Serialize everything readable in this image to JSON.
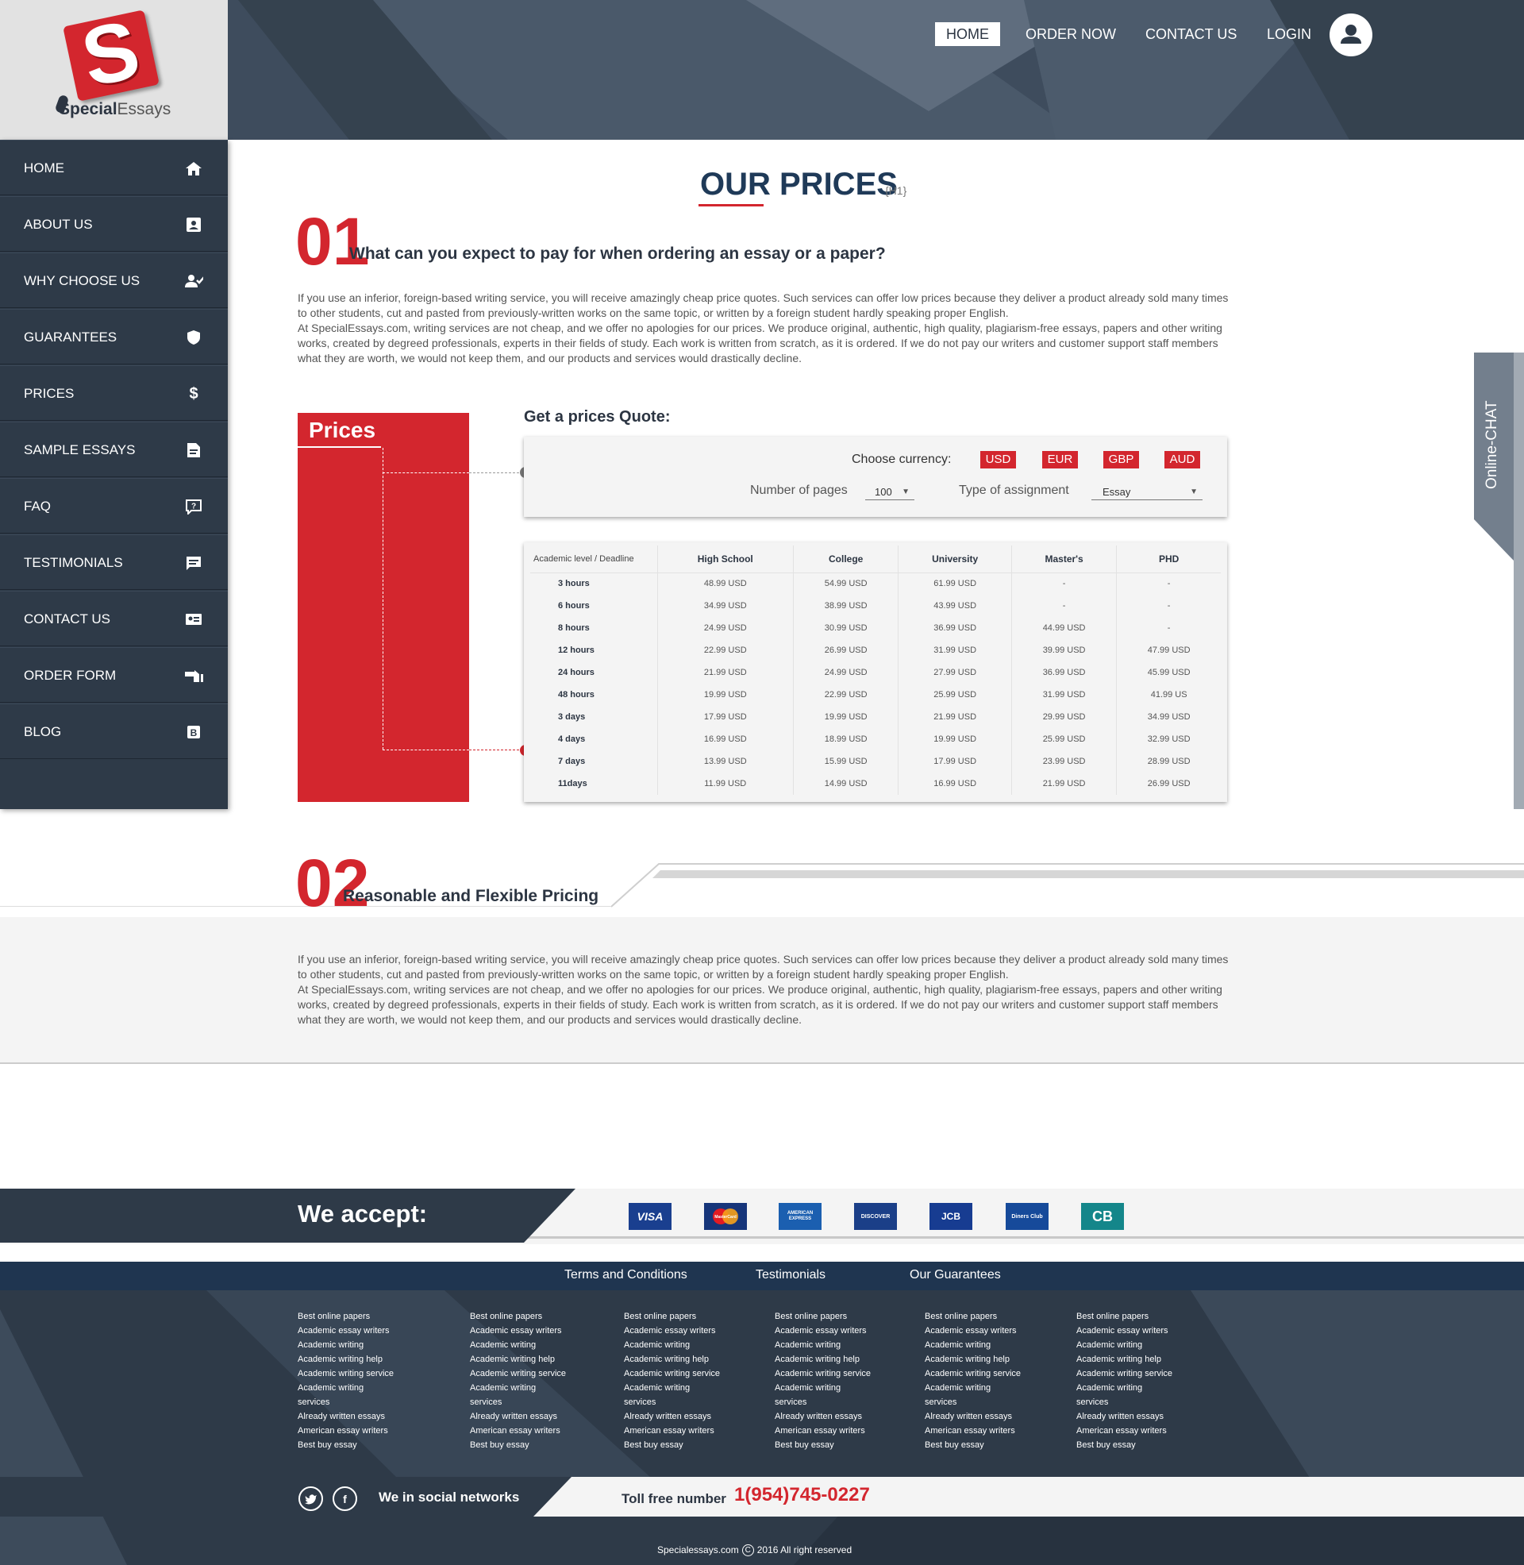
{
  "brand": {
    "name_bold": "Special",
    "name_light": "Essays",
    "logo_letter": "S"
  },
  "topnav": {
    "items": [
      {
        "label": "HOME",
        "active": true
      },
      {
        "label": "ORDER NOW",
        "active": false
      },
      {
        "label": "CONTACT US",
        "active": false
      },
      {
        "label": "LOGIN",
        "active": false
      }
    ],
    "avatar_icon": "user-icon"
  },
  "sidebar": {
    "items": [
      {
        "label": "HOME",
        "icon": "home-icon"
      },
      {
        "label": "ABOUT US",
        "icon": "contact-card-icon"
      },
      {
        "label": "WHY CHOOSE US",
        "icon": "user-check-icon"
      },
      {
        "label": "GUARANTEES",
        "icon": "shield-icon"
      },
      {
        "label": "PRICES",
        "icon": "dollar-icon"
      },
      {
        "label": "SAMPLE ESSAYS",
        "icon": "document-icon"
      },
      {
        "label": "FAQ",
        "icon": "question-bubble-icon"
      },
      {
        "label": "TESTIMONIALS",
        "icon": "comment-icon"
      },
      {
        "label": "CONTACT US",
        "icon": "id-card-icon"
      },
      {
        "label": "ORDER FORM",
        "icon": "hand-pointer-icon"
      },
      {
        "label": "BLOG",
        "icon": "blog-icon"
      }
    ]
  },
  "page": {
    "title": "OUR PRICES",
    "title_tag": "{H1}"
  },
  "section1": {
    "number": "01",
    "heading": "What can you expect to pay  for when ordering an essay or a paper?",
    "paragraph1": "If you use an inferior, foreign-based writing service, you will receive amazingly cheap price quotes.  Such services can offer low prices because they deliver a product already sold many times to other students, cut and pasted from previously-written works on the same topic, or written by a foreign student hardly speaking proper English.",
    "paragraph2": "At SpecialEssays.com, writing services are not cheap, and we offer no apologies for our prices.  We produce original, authentic, high quality, plagiarism-free essays, papers and other writing works, created by degreed professionals, experts in their fields of study.  Each work is written from scratch, as it is ordered.  If we do not pay our writers and customer support staff members what they are worth, we would not keep them, and our products and services would drastically decline."
  },
  "prices_panel": {
    "title": "Prices"
  },
  "quote": {
    "title": "Get a prices Quote:",
    "currency_label": "Choose currency:",
    "currencies": [
      "USD",
      "EUR",
      "GBP",
      "AUD"
    ],
    "pages_label": "Number of pages",
    "pages_value": "100",
    "type_label": "Type of assignment",
    "type_value": "Essay"
  },
  "price_table": {
    "headers": [
      "Academic level / Deadline",
      "High School",
      "College",
      "University",
      "Master's",
      "PHD"
    ],
    "rows": [
      [
        "3 hours",
        "48.99 USD",
        "54.99 USD",
        "61.99 USD",
        "-",
        "-"
      ],
      [
        "6 hours",
        "34.99 USD",
        "38.99 USD",
        "43.99 USD",
        "-",
        "-"
      ],
      [
        "8 hours",
        "24.99 USD",
        "30.99 USD",
        "36.99 USD",
        "44.99 USD",
        "-"
      ],
      [
        "12 hours",
        "22.99 USD",
        "26.99 USD",
        "31.99 USD",
        "39.99 USD",
        "47.99 USD"
      ],
      [
        "24 hours",
        "21.99 USD",
        "24.99 USD",
        "27.99 USD",
        "36.99 USD",
        "45.99 USD"
      ],
      [
        "48 hours",
        "19.99 USD",
        "22.99 USD",
        "25.99 USD",
        "31.99 USD",
        "41.99 US"
      ],
      [
        "3 days",
        "17.99 USD",
        "19.99 USD",
        "21.99 USD",
        "29.99 USD",
        "34.99 USD"
      ],
      [
        "4 days",
        "16.99 USD",
        "18.99 USD",
        "19.99 USD",
        "25.99 USD",
        "32.99 USD"
      ],
      [
        "7 days",
        "13.99 USD",
        "15.99 USD",
        "17.99 USD",
        "23.99 USD",
        "28.99 USD"
      ],
      [
        "11days",
        "11.99 USD",
        "14.99 USD",
        "16.99 USD",
        "21.99 USD",
        "26.99 USD"
      ]
    ]
  },
  "section2": {
    "number": "02",
    "heading": "Reasonable and Flexible Pricing",
    "paragraph1": "If you use an inferior, foreign-based writing service, you will receive amazingly cheap price quotes.  Such services can offer low prices because they deliver a product already sold many times to other students, cut and pasted from previously-written works on the same topic, or written by a foreign student hardly speaking proper English.",
    "paragraph2": "At SpecialEssays.com, writing services are not cheap, and we offer no apologies for our prices.  We produce original, authentic, high quality, plagiarism-free essays, papers and other writing works, created by degreed professionals, experts in their fields of study.  Each work is written from scratch, as it is ordered.  If we do not pay our writers and customer support staff members what they are worth, we would not keep them, and our products and services would drastically decline."
  },
  "chat": {
    "label": "Online-CHAT"
  },
  "accept": {
    "title": "We accept:",
    "cards": [
      {
        "name": "visa-logo",
        "text": "VISA",
        "color": "#1a3f8f"
      },
      {
        "name": "mastercard-logo",
        "text": "MasterCard",
        "color": "#16357a"
      },
      {
        "name": "amex-logo",
        "text": "AMERICAN EXPRESS",
        "color": "#1b5fb0"
      },
      {
        "name": "discover-logo",
        "text": "DISCOVER",
        "color": "#1b3f88"
      },
      {
        "name": "jcb-logo",
        "text": "JCB",
        "color": "#173c91"
      },
      {
        "name": "diners-logo",
        "text": "Diners Club",
        "color": "#164a9a"
      },
      {
        "name": "cb-logo",
        "text": "CB",
        "color": "#14868a"
      }
    ]
  },
  "footer": {
    "top_links": [
      "Terms and Conditions",
      "Testimonials",
      "Our Guarantees"
    ],
    "columns": [
      [
        "Best online papers",
        "Academic essay writers",
        "Academic writing",
        "Academic writing help",
        "Academic writing service",
        "Academic writing",
        "services",
        "Already written essays",
        "American essay writers",
        "Best buy essay"
      ],
      [
        "Best online papers",
        "Academic essay writers",
        "Academic writing",
        "Academic writing help",
        "Academic writing service",
        "Academic writing",
        "services",
        "Already written essays",
        "American essay writers",
        "Best buy essay"
      ],
      [
        "Best online papers",
        "Academic essay writers",
        "Academic writing",
        "Academic writing help",
        "Academic writing service",
        "Academic writing",
        "services",
        "Already written essays",
        "American essay writers",
        "Best buy essay"
      ],
      [
        "Best online papers",
        "Academic essay writers",
        "Academic writing",
        "Academic writing help",
        "Academic writing service",
        "Academic writing",
        "services",
        "Already written essays",
        "American essay writers",
        "Best buy essay"
      ],
      [
        "Best online papers",
        "Academic essay writers",
        "Academic writing",
        "Academic writing help",
        "Academic writing service",
        "Academic writing",
        "services",
        "Already written essays",
        "American essay writers",
        "Best buy essay"
      ],
      [
        "Best online papers",
        "Academic essay writers",
        "Academic writing",
        "Academic writing help",
        "Academic writing service",
        "Academic writing",
        "services",
        "Already written essays",
        "American essay writers",
        "Best buy essay"
      ]
    ],
    "social_text": "We in social networks",
    "social_icons": [
      "twitter-icon",
      "facebook-icon"
    ],
    "tollfree_label": "Toll free number",
    "tollfree_number": "1(954)745-0227",
    "copyright_site": "Specialessays.com",
    "copyright_rest": "2016 All right reserved"
  },
  "colors": {
    "accent": "#d3262e",
    "dark": "#2e3a48",
    "header": "#3e4c5d",
    "navy": "#1f3a58"
  }
}
